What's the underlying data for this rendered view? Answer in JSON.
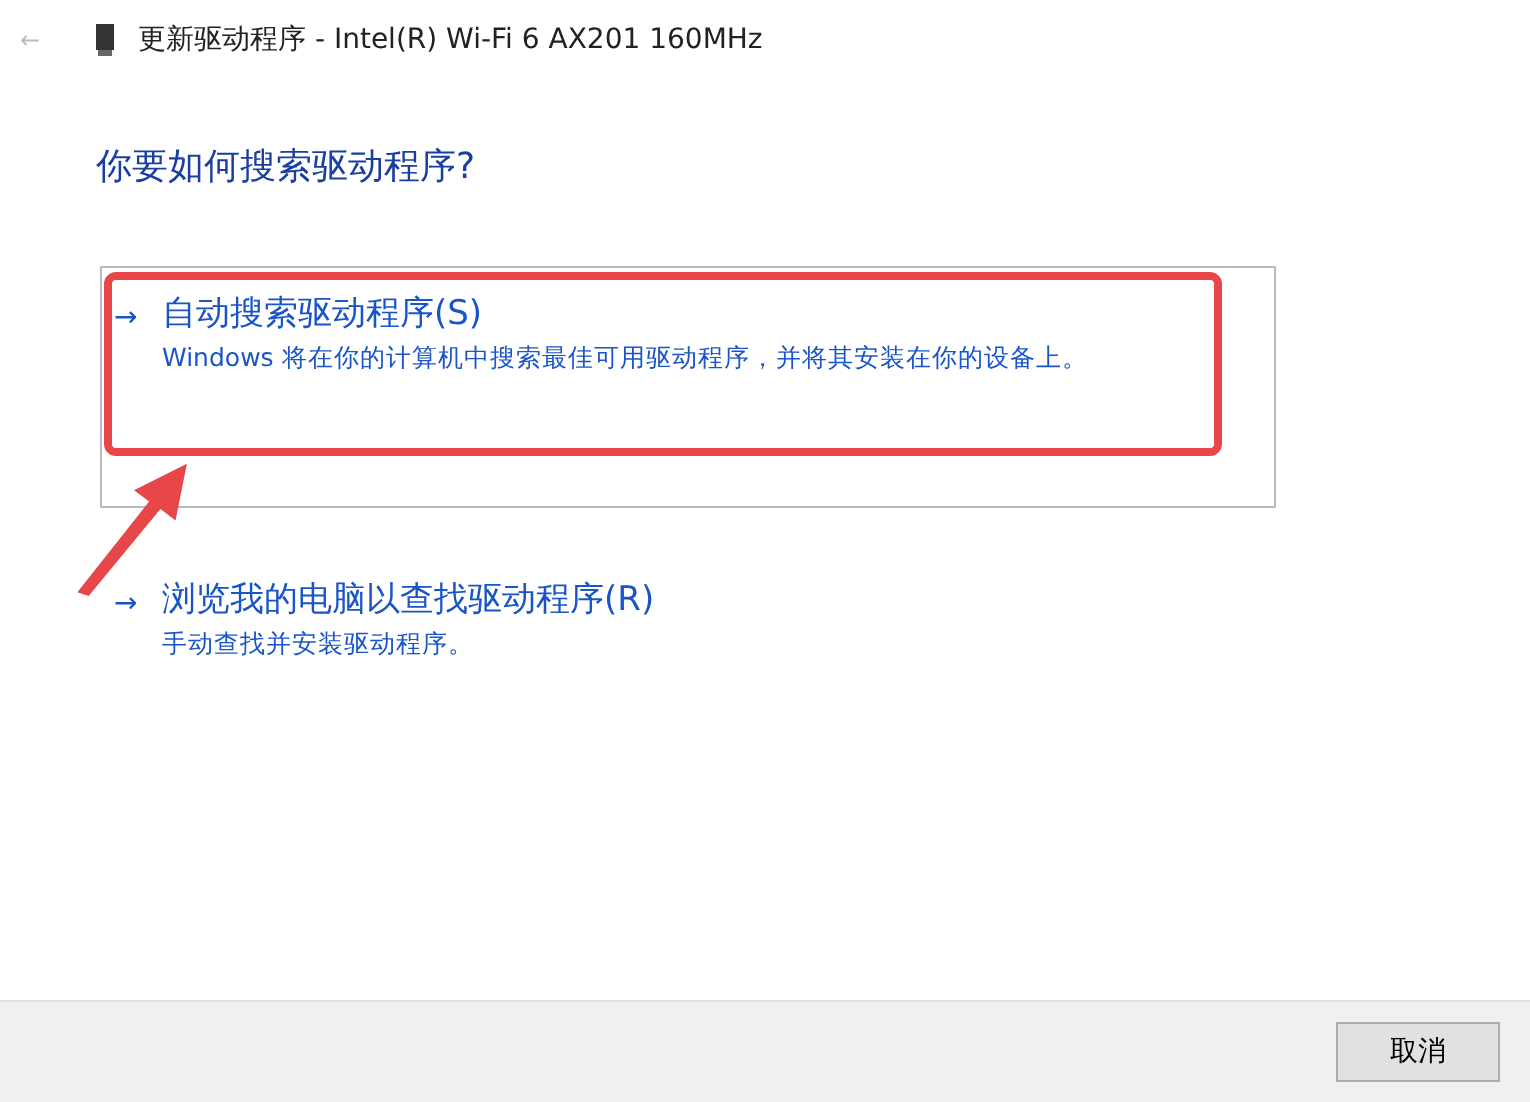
{
  "window": {
    "back": "←",
    "title": "更新驱动程序 - Intel(R) Wi-Fi 6 AX201 160MHz"
  },
  "heading": "你要如何搜索驱动程序?",
  "options": [
    {
      "arrow": "→",
      "title": "自动搜索驱动程序(S)",
      "description": "Windows 将在你的计算机中搜索最佳可用驱动程序，并将其安装在你的设备上。",
      "selected": true
    },
    {
      "arrow": "→",
      "title": "浏览我的电脑以查找驱动程序(R)",
      "description": "手动查找并安装驱动程序。",
      "selected": false
    }
  ],
  "buttons": [
    "取消"
  ]
}
